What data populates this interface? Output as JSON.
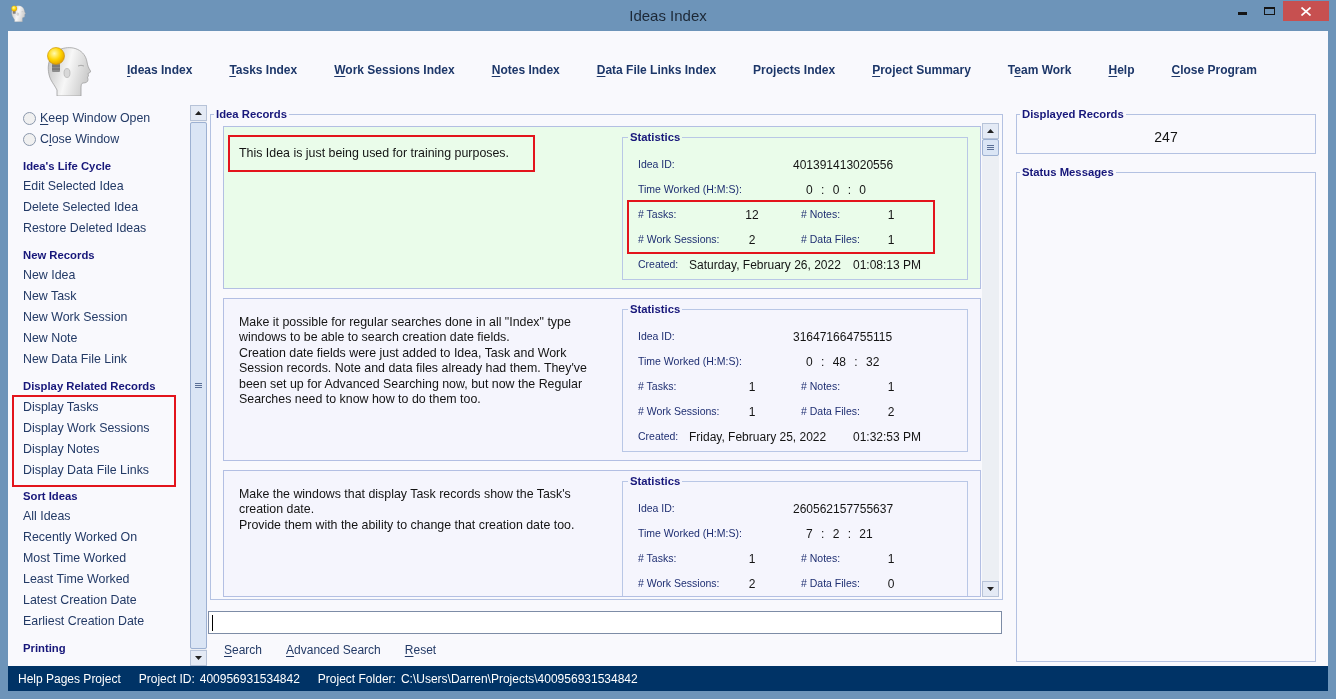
{
  "window": {
    "title": "Ideas Index"
  },
  "menu": [
    {
      "label": "Ideas Index",
      "kind": "underline-first"
    },
    {
      "label": "Tasks Index",
      "kind": "underline-first"
    },
    {
      "label": "Work Sessions Index",
      "kind": "underline-first"
    },
    {
      "label": "Notes Index",
      "kind": "underline-first"
    },
    {
      "label": "Data File Links Index",
      "kind": "underline-first"
    },
    {
      "label": "Projects Index",
      "kind": "plain"
    },
    {
      "label": "Project Summary",
      "kind": "underline-first"
    },
    {
      "label": "Team Work",
      "kind": "underline-second"
    },
    {
      "label": "Help",
      "kind": "underline-first"
    },
    {
      "label": "Close Program",
      "kind": "underline-first"
    }
  ],
  "sidebar": {
    "window_options": [
      {
        "label": "Keep Window Open",
        "kind": "underline-first",
        "selected": false
      },
      {
        "label": "Close Window",
        "kind": "underline-second",
        "selected": false
      }
    ],
    "sections": [
      {
        "title": "Idea's Life Cycle",
        "highlighted": false,
        "items": [
          "Edit Selected Idea",
          "Delete Selected Idea",
          "Restore Deleted Ideas"
        ]
      },
      {
        "title": "New Records",
        "highlighted": false,
        "items": [
          "New Idea",
          "New Task",
          "New Work Session",
          "New Note",
          "New Data File Link"
        ]
      },
      {
        "title": "Display Related Records",
        "highlighted": true,
        "items": [
          "Display Tasks",
          "Display Work Sessions",
          "Display Notes",
          "Display Data File Links"
        ]
      },
      {
        "title": "Sort Ideas",
        "highlighted": false,
        "items": [
          "All Ideas",
          "Recently Worked On",
          "Most Time Worked",
          "Least Time Worked",
          "Latest Creation Date",
          "Earliest Creation Date"
        ]
      },
      {
        "title": "Printing"
      }
    ]
  },
  "records_panel": {
    "title": "Idea Records",
    "records": [
      {
        "selected": true,
        "description": "This Idea is just being used for training purposes.",
        "description_highlighted": true,
        "statistics": {
          "title": "Statistics",
          "idea_id": {
            "label": "Idea ID:",
            "value": "401391413020556"
          },
          "time_worked": {
            "label": "Time Worked (H:M:S):",
            "value": "0 : 0 : 0"
          },
          "counts": {
            "highlighted": true,
            "items": [
              {
                "label": "# Tasks:",
                "value": "12"
              },
              {
                "label": "# Notes:",
                "value": "1"
              },
              {
                "label": "# Work Sessions:",
                "value": "2"
              },
              {
                "label": "# Data Files:",
                "value": "1"
              }
            ]
          },
          "created": {
            "label": "Created:",
            "date": "Saturday, February 26, 2022",
            "time": "01:08:13 PM"
          }
        }
      },
      {
        "selected": false,
        "description": "Make it possible for regular searches done in all \"Index\" type windows to be able to search creation date fields.\nCreation date fields were just added to Idea, Task and Work Session records. Note and data files already had them. They've been set up for Advanced Searching now, but now the Regular Searches need to know how to do them too.",
        "description_highlighted": false,
        "statistics": {
          "title": "Statistics",
          "idea_id": {
            "label": "Idea ID:",
            "value": "316471664755115"
          },
          "time_worked": {
            "label": "Time Worked (H:M:S):",
            "value": "0 : 48 : 32"
          },
          "counts": {
            "highlighted": false,
            "items": [
              {
                "label": "# Tasks:",
                "value": "1"
              },
              {
                "label": "# Notes:",
                "value": "1"
              },
              {
                "label": "# Work Sessions:",
                "value": "1"
              },
              {
                "label": "# Data Files:",
                "value": "2"
              }
            ]
          },
          "created": {
            "label": "Created:",
            "date": "Friday, February 25, 2022",
            "time": "01:32:53 PM"
          }
        }
      },
      {
        "selected": false,
        "description": "Make the windows that display Task records show the Task's creation date.\nProvide them with the ability to change that creation date too.",
        "description_highlighted": false,
        "statistics": {
          "title": "Statistics",
          "idea_id": {
            "label": "Idea ID:",
            "value": "260562157755637"
          },
          "time_worked": {
            "label": "Time Worked (H:M:S):",
            "value": "7 : 2 : 21"
          },
          "counts": {
            "highlighted": false,
            "items": [
              {
                "label": "# Tasks:",
                "value": "1"
              },
              {
                "label": "# Notes:",
                "value": "1"
              },
              {
                "label": "# Work Sessions:",
                "value": "2"
              },
              {
                "label": "# Data Files:",
                "value": "0"
              }
            ]
          }
        }
      }
    ]
  },
  "search": {
    "focused": true,
    "actions": [
      {
        "label": "Search",
        "kind": "underline-first"
      },
      {
        "label": "Advanced Search",
        "kind": "underline-first"
      },
      {
        "label": "Reset",
        "kind": "underline-first"
      }
    ]
  },
  "displayed_records": {
    "title": "Displayed Records",
    "value": "247"
  },
  "status_messages": {
    "title": "Status Messages"
  },
  "status_bar": {
    "project_name": "Help Pages Project",
    "project_id": {
      "label": "Project ID:",
      "value": "400956931534842"
    },
    "project_folder": {
      "label": "Project Folder:",
      "value": "C:\\Users\\Darren\\Projects\\400956931534842"
    }
  }
}
